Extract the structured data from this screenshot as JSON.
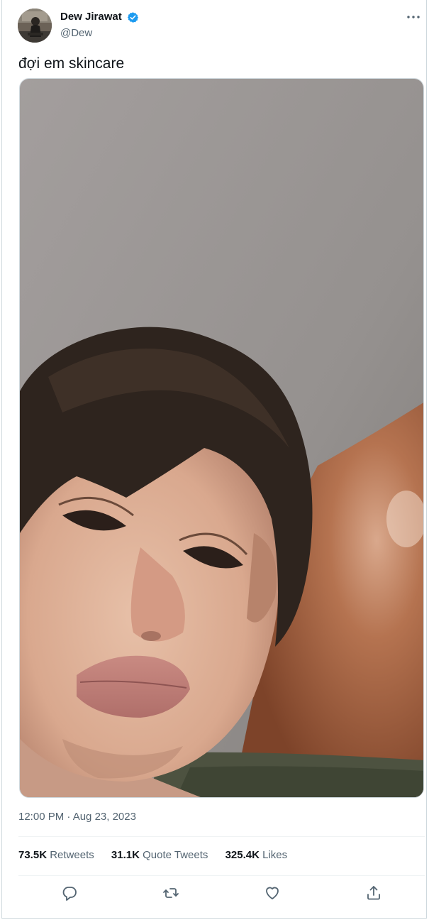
{
  "tweet": {
    "display_name": "Dew Jirawat",
    "handle": "@Dew",
    "verified_icon": "verified-badge-icon",
    "more_icon": "more-options-icon",
    "text": "đợi em skincare",
    "media": {
      "kind": "photo"
    },
    "timestamp": "12:00 PM · Aug 23, 2023"
  },
  "stats": {
    "retweets_count": "73.5K",
    "retweets_label": "Retweets",
    "quotes_count": "31.1K",
    "quotes_label": "Quote Tweets",
    "likes_count": "325.4K",
    "likes_label": "Likes"
  },
  "actions": {
    "reply_icon": "reply-icon",
    "retweet_icon": "retweet-icon",
    "like_icon": "heart-icon",
    "share_icon": "share-icon"
  },
  "colors": {
    "accent": "#1d9bf0",
    "text_primary": "#0f1419",
    "text_secondary": "#536471",
    "border": "#cfd9de"
  }
}
